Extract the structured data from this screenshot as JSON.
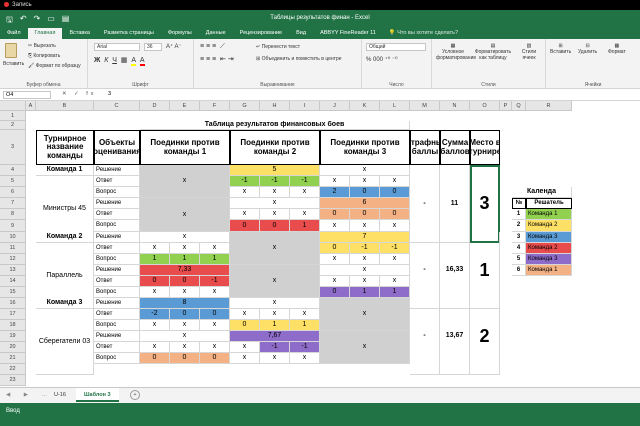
{
  "recording": {
    "label": "Запись"
  },
  "window": {
    "title": "Таблицы результатов финан - Excel"
  },
  "qat_icons": [
    "save-icon",
    "undo-icon",
    "redo-icon",
    "new-doc-icon",
    "open-folder-icon"
  ],
  "tabs": [
    {
      "label": "Файл"
    },
    {
      "label": "Главная"
    },
    {
      "label": "Вставка"
    },
    {
      "label": "Разметка страницы"
    },
    {
      "label": "Формулы"
    },
    {
      "label": "Данные"
    },
    {
      "label": "Рецензирование"
    },
    {
      "label": "Вид"
    },
    {
      "label": "ABBYY FineReader 11"
    }
  ],
  "tab_search": "Что вы хотите сделать?",
  "ribbon": {
    "clipboard": {
      "label": "Буфер обмена",
      "paste": "Вставить",
      "cut": "Вырезать",
      "copy": "Копировать",
      "painter": "Формат по образцу"
    },
    "font": {
      "label": "Шрифт",
      "name": "Arial",
      "size": "36"
    },
    "alignment": {
      "label": "Выравнивание",
      "wrap": "Перенести текст",
      "merge": "Объединить и поместить в центре"
    },
    "number": {
      "label": "Число",
      "format": "Общий"
    },
    "styles": {
      "label": "Стили",
      "cond": "Условное форматирование",
      "as_table": "Форматировать как таблицу",
      "cell_styles": "Стили ячеек"
    },
    "cells": {
      "label": "Ячейки",
      "insert": "Вставить",
      "delete": "Удалить",
      "format": "Формат"
    }
  },
  "formula_bar": {
    "name_box": "O4",
    "fx": "✕ ✓ fx",
    "value": "3"
  },
  "columns": [
    "A",
    "B",
    "C",
    "D",
    "E",
    "F",
    "G",
    "H",
    "I",
    "J",
    "K",
    "L",
    "M",
    "N",
    "O",
    "P",
    "Q",
    "R"
  ],
  "rows": [
    "1",
    "2",
    "3",
    "4",
    "5",
    "6",
    "7",
    "8",
    "9",
    "10",
    "11",
    "12",
    "13",
    "14",
    "15",
    "16",
    "17",
    "18",
    "19",
    "20",
    "21",
    "22",
    "23"
  ],
  "sheet": {
    "title": "Таблица результатов финансовых боев",
    "h_team": "Турнирное название команды",
    "h_obj": "Объекты оценивания",
    "h_f1": "Поединки против команды 1",
    "h_f2": "Поединки против команды 2",
    "h_f3": "Поединки против команды 3",
    "h_pen": "Штрафные баллы",
    "h_sum": "Сумма баллов",
    "h_place": "Место в турнире",
    "team1": "Команда 1",
    "team1_name": "Министры 45",
    "team1_sum": "11",
    "team1_place": "3",
    "team1_pen": "-",
    "team2": "Команда 2",
    "team2_name": "Параллель",
    "team2_sum": "16,33",
    "team2_place": "1",
    "team2_pen": "-",
    "team3": "Команда 3",
    "team3_name": "Сберегатели 03",
    "team3_sum": "13,67",
    "team3_place": "2",
    "team3_pen": "-",
    "obj_decision": "Решение",
    "obj_answer": "Ответ",
    "obj_question": "Вопрос",
    "x": "x",
    "v5": "5",
    "vm1": "-1",
    "v2": "2",
    "v0": "0",
    "v1": "1",
    "v6": "6",
    "v7": "7",
    "v733": "7,33",
    "v8": "8",
    "vm2": "-2",
    "v767": "7,67",
    "cal_title": "Календа",
    "cal_no": "№",
    "cal_solver": "Решатель",
    "cal_rows": [
      {
        "no": "1",
        "team": "Команда 1"
      },
      {
        "no": "2",
        "team": "Команда 2"
      },
      {
        "no": "3",
        "team": "Команда 3"
      },
      {
        "no": "4",
        "team": "Команда 2"
      },
      {
        "no": "5",
        "team": "Команда 3"
      },
      {
        "no": "6",
        "team": "Команда 1"
      }
    ]
  },
  "sheet_tabs": [
    {
      "label": "U-16"
    },
    {
      "label": "Шаблон 3"
    }
  ],
  "status": {
    "ready": "Ввод"
  },
  "colors": {
    "green": "#92d050",
    "blue": "#5b9bd5",
    "red": "#e84c4c",
    "orange": "#f4b183",
    "yellow": "#ffe066",
    "purple": "#8e6cc9",
    "gray": "#d0d0d0"
  }
}
